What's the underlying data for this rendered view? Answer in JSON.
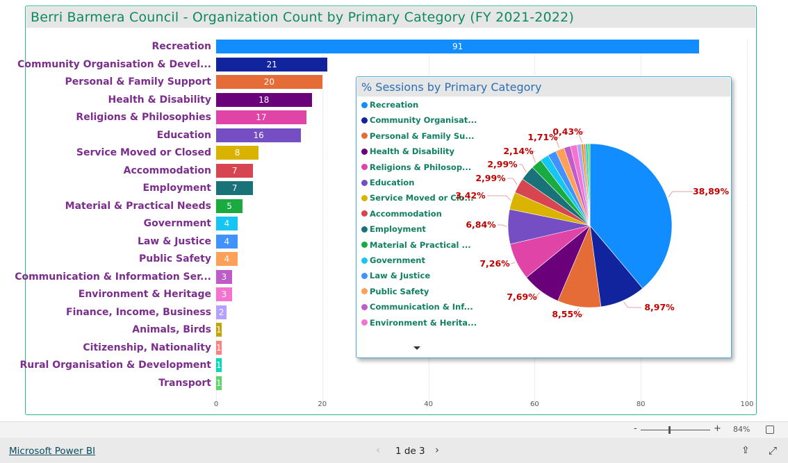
{
  "report": {
    "title": "Berri Barmera Council - Organization Count by Primary Category (FY 2021-2022)",
    "pie_title": "% Sessions by Primary Category"
  },
  "chart_data": [
    {
      "type": "bar",
      "orientation": "horizontal",
      "title": "Berri Barmera Council - Organization Count by Primary Category (FY 2021-2022)",
      "categories": [
        "Recreation",
        "Community Organisation & Devel...",
        "Personal & Family Support",
        "Health & Disability",
        "Religions & Philosophies",
        "Education",
        "Service Moved or Closed",
        "Accommodation",
        "Employment",
        "Material & Practical Needs",
        "Government",
        "Law & Justice",
        "Public Safety",
        "Communication & Information Ser...",
        "Environment & Heritage",
        "Finance, Income, Business",
        "Animals, Birds",
        "Citizenship, Nationality",
        "Rural Organisation & Development",
        "Transport"
      ],
      "values": [
        91,
        21,
        20,
        18,
        17,
        16,
        8,
        7,
        7,
        5,
        4,
        4,
        4,
        3,
        3,
        2,
        1,
        1,
        1,
        1
      ],
      "colors": [
        "#118dff",
        "#12239e",
        "#e66c37",
        "#6b007b",
        "#e044a7",
        "#744ec2",
        "#d9b300",
        "#d64550",
        "#197278",
        "#1aab40",
        "#15c6f4",
        "#4092ff",
        "#ffa058",
        "#be5dc9",
        "#f472d0",
        "#b5a1ff",
        "#c4a200",
        "#ff8080",
        "#00dbbc",
        "#5bd667"
      ],
      "xlim": [
        0,
        100
      ],
      "xticks": [
        "0",
        "20",
        "40",
        "60",
        "80",
        "100"
      ],
      "grid": true
    },
    {
      "type": "pie",
      "title": "% Sessions by Primary Category",
      "legend_position": "left",
      "legend": [
        "Recreation",
        "Community Organisat...",
        "Personal & Family Su...",
        "Health & Disability",
        "Religions & Philosop...",
        "Education",
        "Service Moved or Clo...",
        "Accommodation",
        "Employment",
        "Material & Practical ...",
        "Government",
        "Law & Justice",
        "Public Safety",
        "Communication & Inf...",
        "Environment & Herita..."
      ],
      "values": [
        38.89,
        8.97,
        8.55,
        7.69,
        7.26,
        6.84,
        3.42,
        2.99,
        2.99,
        2.14,
        1.71,
        1.71,
        1.71,
        1.28,
        1.28,
        0.85,
        0.43,
        0.43,
        0.43,
        0.43
      ],
      "labels": [
        "38,89%",
        "8,97%",
        "8,55%",
        "7,69%",
        "7,26%",
        "6,84%",
        "3,42%",
        "2,99%",
        "2,99%",
        "2,14%",
        "",
        "",
        "1,71%",
        "",
        "",
        "",
        "0,43%",
        "",
        "",
        ""
      ]
    }
  ],
  "zoom": {
    "minus": "-",
    "plus": "+",
    "level": "84%",
    "level_value": 84
  },
  "footer": {
    "brand": "Microsoft Power BI",
    "page": "1 de 3"
  }
}
